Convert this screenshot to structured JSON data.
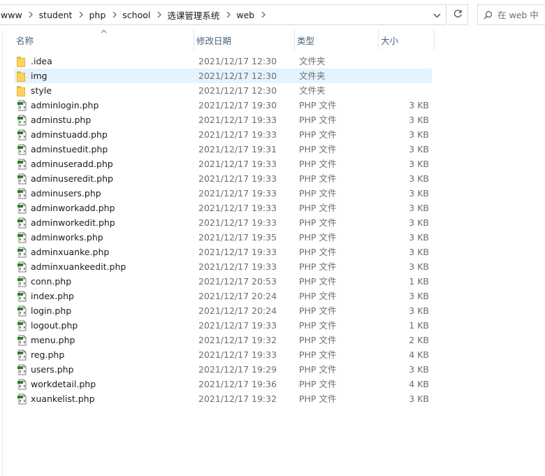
{
  "breadcrumb": [
    {
      "label": "www"
    },
    {
      "label": "student"
    },
    {
      "label": "php"
    },
    {
      "label": "school"
    },
    {
      "label": "选课管理系统"
    },
    {
      "label": "web"
    }
  ],
  "search": {
    "placeholder": "在 web 中"
  },
  "columns": {
    "name": "名称",
    "date": "修改日期",
    "type": "类型",
    "size": "大小"
  },
  "files": [
    {
      "name": ".idea",
      "date": "2021/12/17 12:30",
      "type": "文件夹",
      "size": "",
      "icon": "folder-icon"
    },
    {
      "name": "img",
      "date": "2021/12/17 12:30",
      "type": "文件夹",
      "size": "",
      "icon": "folder-icon",
      "selected": true
    },
    {
      "name": "style",
      "date": "2021/12/17 12:30",
      "type": "文件夹",
      "size": "",
      "icon": "folder-icon"
    },
    {
      "name": "adminlogin.php",
      "date": "2021/12/17 19:30",
      "type": "PHP 文件",
      "size": "3 KB",
      "icon": "php-file-icon"
    },
    {
      "name": "adminstu.php",
      "date": "2021/12/17 19:33",
      "type": "PHP 文件",
      "size": "3 KB",
      "icon": "php-file-icon"
    },
    {
      "name": "adminstuadd.php",
      "date": "2021/12/17 19:33",
      "type": "PHP 文件",
      "size": "3 KB",
      "icon": "php-file-icon"
    },
    {
      "name": "adminstuedit.php",
      "date": "2021/12/17 19:31",
      "type": "PHP 文件",
      "size": "3 KB",
      "icon": "php-file-icon"
    },
    {
      "name": "adminuseradd.php",
      "date": "2021/12/17 19:33",
      "type": "PHP 文件",
      "size": "3 KB",
      "icon": "php-file-icon"
    },
    {
      "name": "adminuseredit.php",
      "date": "2021/12/17 19:33",
      "type": "PHP 文件",
      "size": "3 KB",
      "icon": "php-file-icon"
    },
    {
      "name": "adminusers.php",
      "date": "2021/12/17 19:33",
      "type": "PHP 文件",
      "size": "3 KB",
      "icon": "php-file-icon"
    },
    {
      "name": "adminworkadd.php",
      "date": "2021/12/17 19:33",
      "type": "PHP 文件",
      "size": "3 KB",
      "icon": "php-file-icon"
    },
    {
      "name": "adminworkedit.php",
      "date": "2021/12/17 19:33",
      "type": "PHP 文件",
      "size": "3 KB",
      "icon": "php-file-icon"
    },
    {
      "name": "adminworks.php",
      "date": "2021/12/17 19:35",
      "type": "PHP 文件",
      "size": "3 KB",
      "icon": "php-file-icon"
    },
    {
      "name": "adminxuanke.php",
      "date": "2021/12/17 19:33",
      "type": "PHP 文件",
      "size": "3 KB",
      "icon": "php-file-icon"
    },
    {
      "name": "adminxuankeedit.php",
      "date": "2021/12/17 19:33",
      "type": "PHP 文件",
      "size": "3 KB",
      "icon": "php-file-icon"
    },
    {
      "name": "conn.php",
      "date": "2021/12/17 20:53",
      "type": "PHP 文件",
      "size": "1 KB",
      "icon": "php-file-icon"
    },
    {
      "name": "index.php",
      "date": "2021/12/17 20:24",
      "type": "PHP 文件",
      "size": "3 KB",
      "icon": "php-file-icon"
    },
    {
      "name": "login.php",
      "date": "2021/12/17 20:24",
      "type": "PHP 文件",
      "size": "3 KB",
      "icon": "php-file-icon"
    },
    {
      "name": "logout.php",
      "date": "2021/12/17 19:33",
      "type": "PHP 文件",
      "size": "1 KB",
      "icon": "php-file-icon"
    },
    {
      "name": "menu.php",
      "date": "2021/12/17 19:32",
      "type": "PHP 文件",
      "size": "2 KB",
      "icon": "php-file-icon"
    },
    {
      "name": "reg.php",
      "date": "2021/12/17 19:33",
      "type": "PHP 文件",
      "size": "4 KB",
      "icon": "php-file-icon"
    },
    {
      "name": "users.php",
      "date": "2021/12/17 19:29",
      "type": "PHP 文件",
      "size": "3 KB",
      "icon": "php-file-icon"
    },
    {
      "name": "workdetail.php",
      "date": "2021/12/17 19:36",
      "type": "PHP 文件",
      "size": "4 KB",
      "icon": "php-file-icon"
    },
    {
      "name": "xuankelist.php",
      "date": "2021/12/17 19:32",
      "type": "PHP 文件",
      "size": "3 KB",
      "icon": "php-file-icon"
    }
  ],
  "colors": {
    "selection": "#e5f3ff",
    "header_text": "#4c607a",
    "folder": "#ffd35b"
  }
}
